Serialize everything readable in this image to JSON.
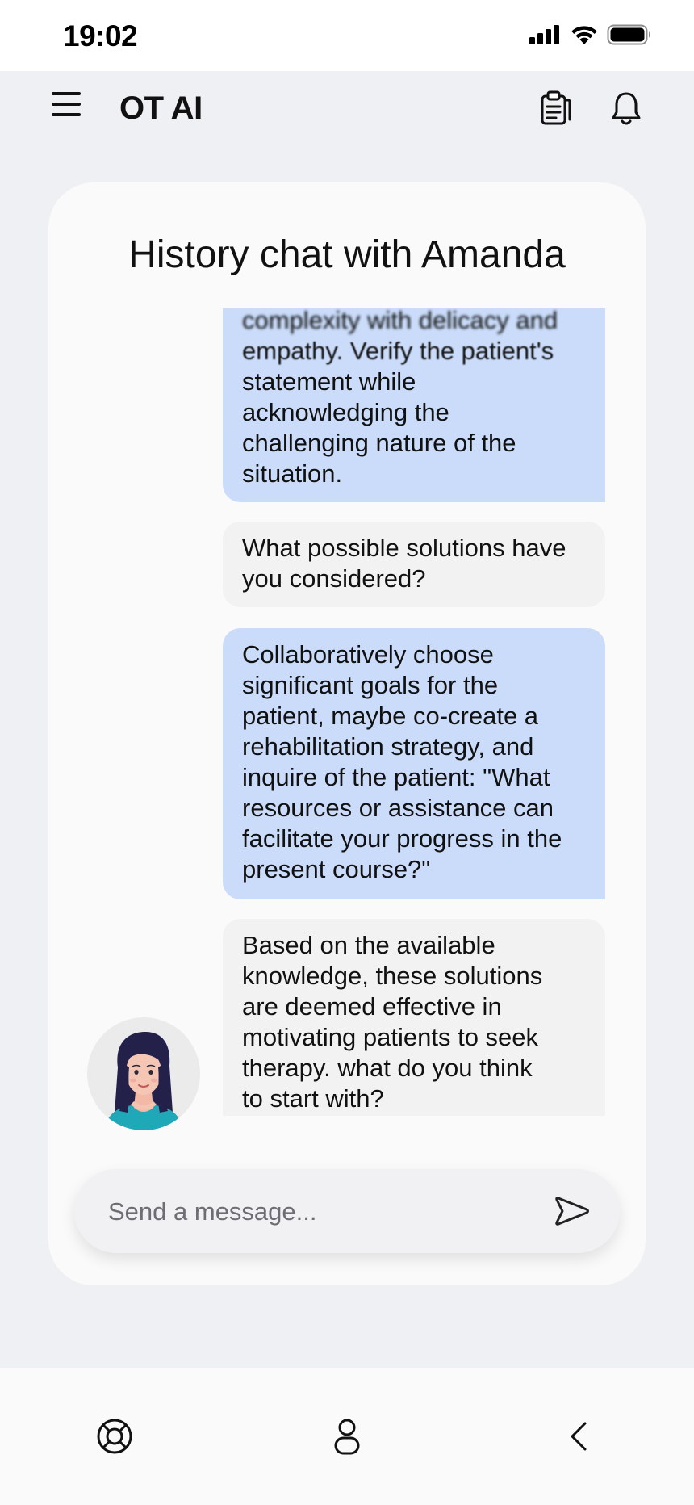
{
  "status_bar": {
    "time": "19:02"
  },
  "header": {
    "title": "OT AI"
  },
  "chat": {
    "title": "History chat with Amanda",
    "messages": [
      {
        "role": "user",
        "lines": [
          "complexity with delicacy and",
          "empathy. Verify the patient's",
          "statement while",
          "acknowledging the",
          "challenging nature of the",
          "situation."
        ]
      },
      {
        "role": "bot",
        "lines": [
          "What possible solutions have",
          "you considered?"
        ]
      },
      {
        "role": "user",
        "lines": [
          "Collaboratively choose",
          "significant goals for the",
          "patient, maybe co-create a",
          "rehabilitation strategy, and",
          "inquire of the patient: \"What",
          "resources or assistance can",
          "facilitate your progress in the",
          "present course?\""
        ]
      },
      {
        "role": "bot",
        "lines": [
          "Based on the available",
          "knowledge, these solutions",
          "are deemed effective in",
          "motivating patients to seek",
          "therapy. what do you think",
          "to start with?"
        ]
      }
    ]
  },
  "composer": {
    "placeholder": "Send a message..."
  },
  "icons": {
    "menu": "hamburger-menu-icon",
    "clipboard": "clipboard-icon",
    "bell": "bell-icon",
    "send": "send-icon",
    "support": "lifebuoy-icon",
    "profile": "person-icon",
    "back": "chevron-left-icon"
  },
  "colors": {
    "user_bubble": "#cadcfa",
    "bot_bubble": "#f2f2f3",
    "background": "#eff0f4"
  }
}
